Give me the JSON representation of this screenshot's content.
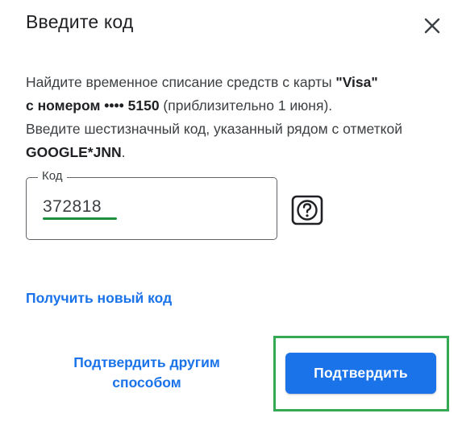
{
  "dialog": {
    "title": "Введите код",
    "close_icon": "close-icon"
  },
  "description": {
    "part1": "Найдите временное списание средств с карты ",
    "card_brand": "\"Visa\"",
    "part2": "с номером •••• 5150",
    "part3": " (приблизительно 1 июня).",
    "part4": "Введите шестизначный код, указанный рядом с отметкой ",
    "merchant": "GOOGLE*JNN",
    "part5": "."
  },
  "code_field": {
    "label": "Код",
    "value": "372818"
  },
  "help_icon": "help-icon",
  "links": {
    "new_code": "Получить новый код"
  },
  "actions": {
    "alternate_line1": "Подтвердить другим",
    "alternate_line2": "способом",
    "confirm": "Подтвердить"
  },
  "colors": {
    "accent": "#1a73e8",
    "highlight_green": "#34a853",
    "underline_green": "#1e8e3e"
  }
}
